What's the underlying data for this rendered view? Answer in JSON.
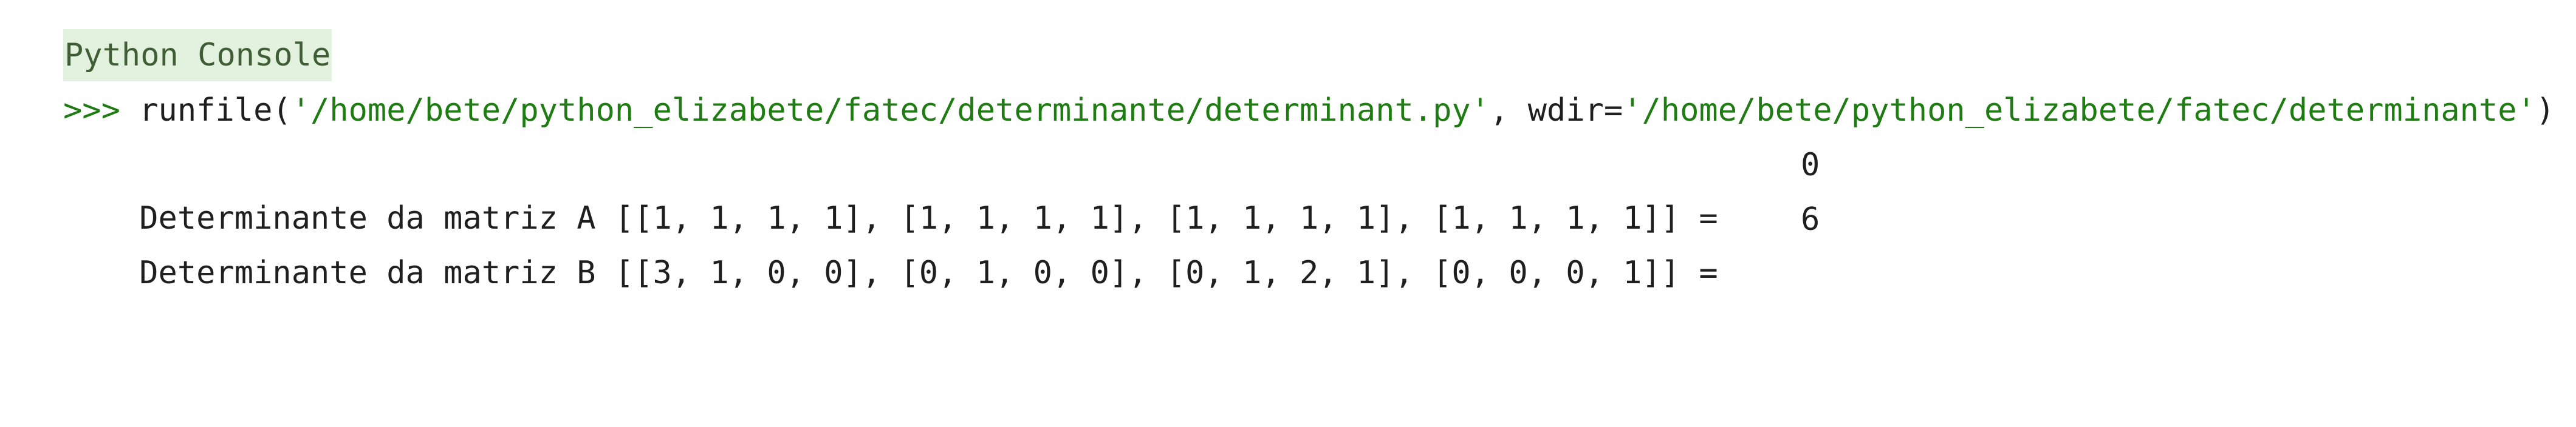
{
  "console": {
    "title": "Python Console",
    "command": {
      "prompt": ">>>",
      "func_open": "runfile(",
      "path": "'/home/bete/python_elizabete/fatec/determinante/determinant.py'",
      "sep": ", wdir=",
      "wdir": "'/home/bete/python_elizabete/fatec/determinante'",
      "close": ")"
    },
    "outputs": [
      {
        "text": "Determinante da matriz A [[1, 1, 1, 1], [1, 1, 1, 1], [1, 1, 1, 1], [1, 1, 1, 1]] =",
        "value": "0"
      },
      {
        "text": "Determinante da matriz B [[3, 1, 0, 0], [0, 1, 0, 0], [0, 1, 2, 1], [0, 0, 0, 1]] =",
        "value": "6"
      }
    ]
  }
}
